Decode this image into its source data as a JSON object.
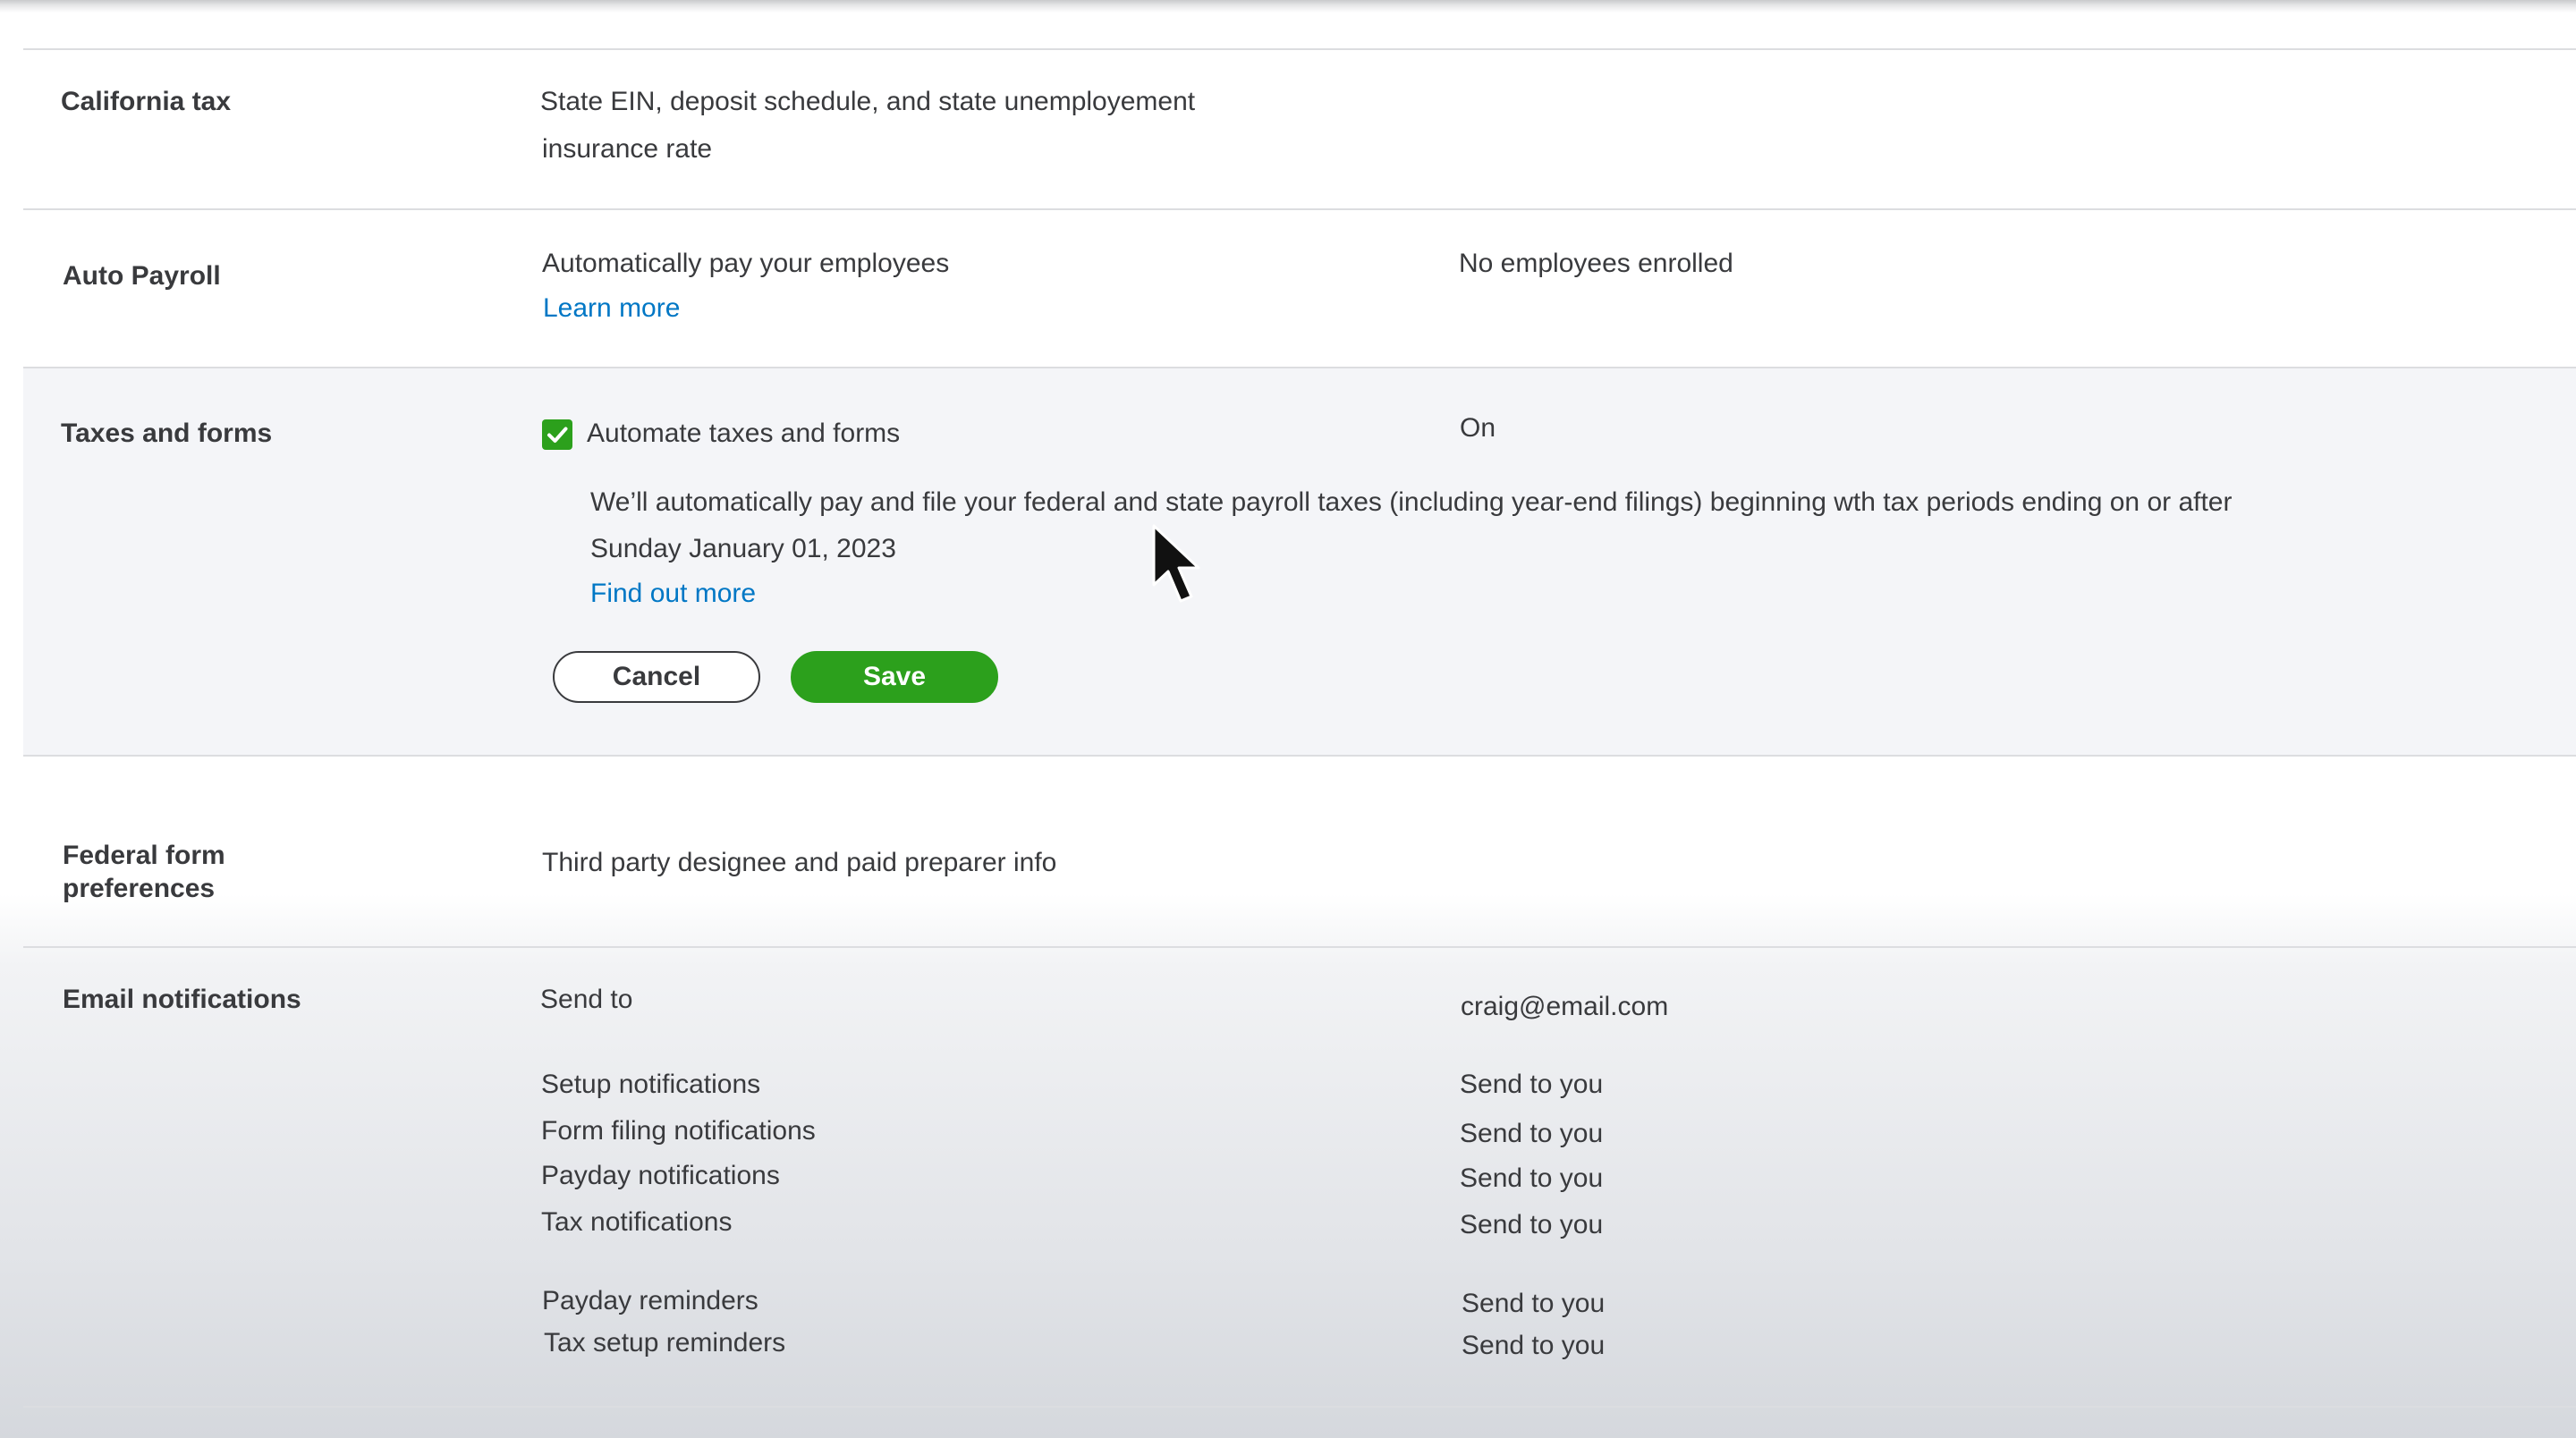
{
  "california_tax": {
    "label": "California tax",
    "description_line1": "State EIN, deposit schedule, and state unemployement",
    "description_line2": "insurance rate"
  },
  "auto_payroll": {
    "label": "Auto Payroll",
    "description": "Automatically pay your employees",
    "link": "Learn more",
    "status": "No employees enrolled"
  },
  "taxes_and_forms": {
    "label": "Taxes and forms",
    "checkbox_label": "Automate taxes and forms",
    "checkbox_checked": true,
    "status": "On",
    "info_text": "We’ll automatically pay and file your federal and state payroll taxes (including year-end filings) beginning wth tax periods ending on or after Sunday January 01, 2023",
    "link": "Find out more",
    "cancel_label": "Cancel",
    "save_label": "Save"
  },
  "federal_form_preferences": {
    "label_line1": "Federal form",
    "label_line2": "preferences",
    "description": "Third party designee and paid preparer info"
  },
  "email_notifications": {
    "label": "Email notifications",
    "send_to_label": "Send to",
    "send_to_value": "craig@email.com",
    "items": [
      {
        "name": "Setup notifications",
        "value": "Send to you"
      },
      {
        "name": "Form filing notifications",
        "value": "Send to you"
      },
      {
        "name": "Payday notifications",
        "value": "Send to you"
      },
      {
        "name": "Tax notifications",
        "value": "Send to you"
      },
      {
        "name": "Payday reminders",
        "value": "Send to you"
      },
      {
        "name": "Tax setup reminders",
        "value": "Send to you"
      }
    ]
  },
  "colors": {
    "accent_green": "#2ca01c",
    "link_blue": "#0077c5",
    "text": "#393a3d"
  }
}
